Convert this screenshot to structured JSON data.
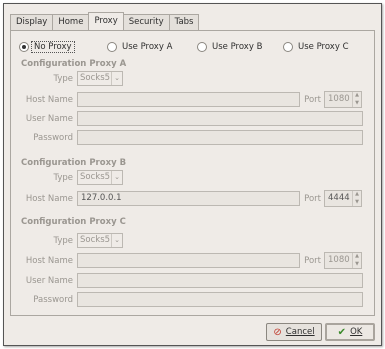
{
  "tabs": [
    "Display",
    "Home",
    "Proxy",
    "Security",
    "Tabs"
  ],
  "active_tab": "Proxy",
  "radios": {
    "no_proxy": "No Proxy",
    "use_a": "Use Proxy A",
    "use_b": "Use Proxy B",
    "use_c": "Use Proxy C",
    "selected": "No Proxy"
  },
  "proxy_a": {
    "title": "Configuration Proxy A",
    "type_label": "Type",
    "type_value": "Socks5",
    "host_label": "Host Name",
    "host_value": "",
    "port_label": "Port",
    "port_value": "1080",
    "user_label": "User Name",
    "user_value": "",
    "pass_label": "Password",
    "pass_value": ""
  },
  "proxy_b": {
    "title": "Configuration Proxy B",
    "type_label": "Type",
    "type_value": "Socks5",
    "host_label": "Host Name",
    "host_value": "127.0.0.1",
    "port_label": "Port",
    "port_value": "4444"
  },
  "proxy_c": {
    "title": "Configuration Proxy C",
    "type_label": "Type",
    "type_value": "Socks5",
    "host_label": "Host Name",
    "host_value": "",
    "port_label": "Port",
    "port_value": "1080",
    "user_label": "User Name",
    "user_value": "",
    "pass_label": "Password",
    "pass_value": ""
  },
  "buttons": {
    "cancel": "Cancel",
    "ok": "OK"
  },
  "icons": {
    "cancel": "cancel-icon",
    "ok": "ok-checkmark-icon"
  }
}
